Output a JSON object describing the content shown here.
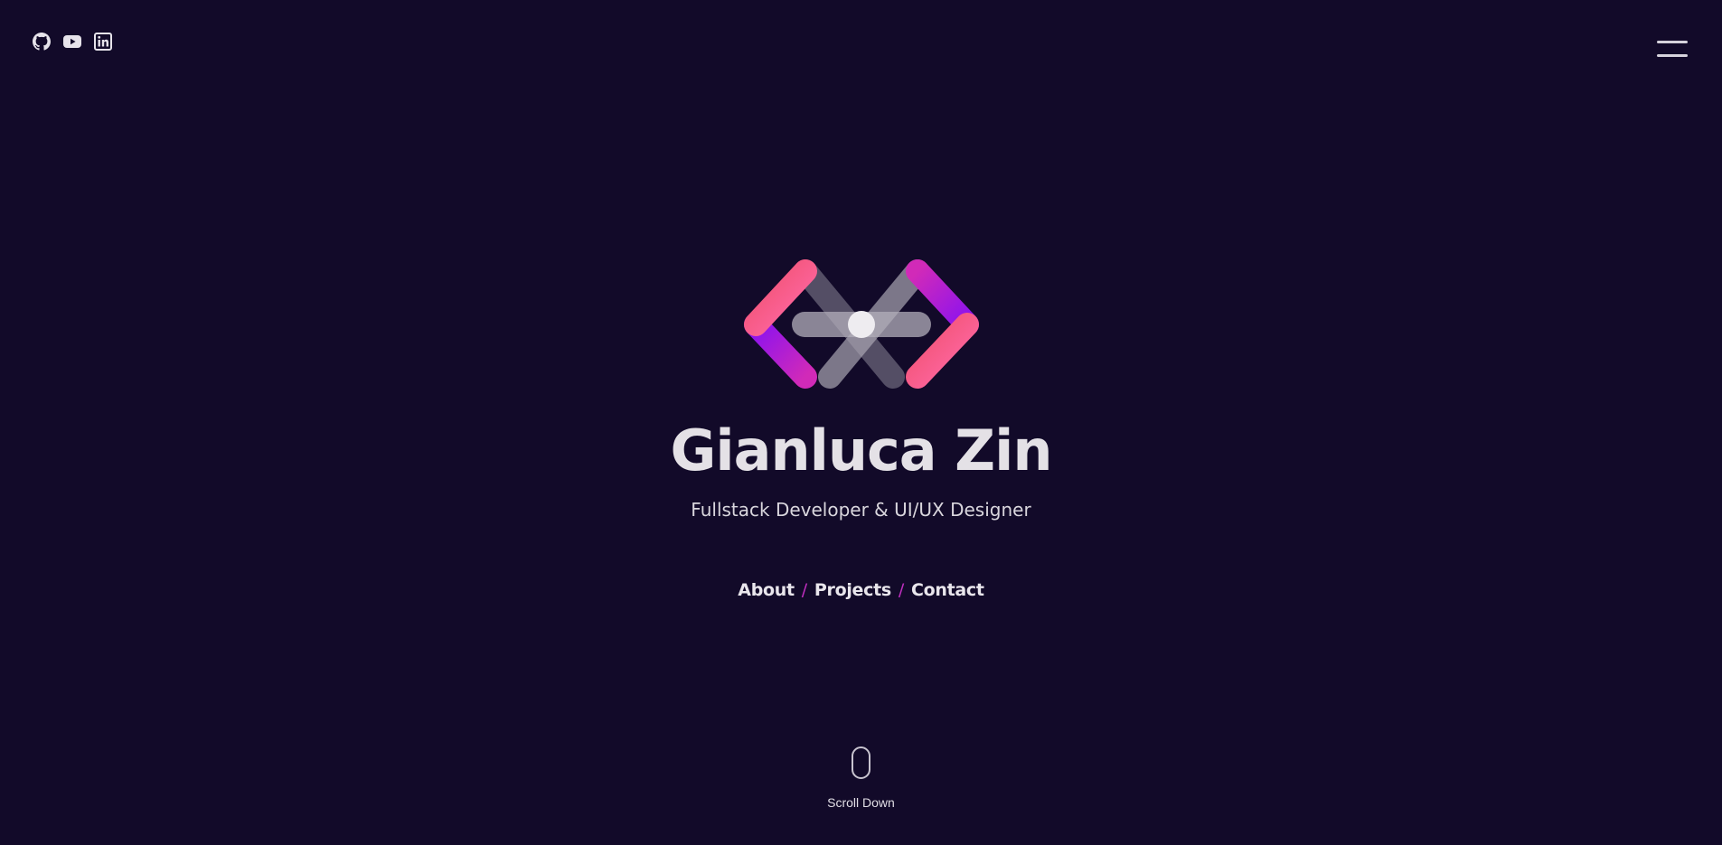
{
  "social": {
    "github_icon": "github-icon",
    "youtube_icon": "youtube-icon",
    "linkedin_icon": "linkedin-icon"
  },
  "menu": {
    "icon": "hamburger-menu-icon"
  },
  "hero": {
    "name": "Gianluca Zin",
    "tagline": "Fullstack Developer & UI/UX Designer"
  },
  "nav": {
    "items": [
      {
        "label": "About"
      },
      {
        "label": "Projects"
      },
      {
        "label": "Contact"
      }
    ],
    "separator": "/"
  },
  "scroll": {
    "label": "Scroll Down",
    "icon": "mouse-icon"
  },
  "colors": {
    "background": "#120a29",
    "accent_pink": "#f5537a",
    "accent_purple": "#9b18e6",
    "separator": "#c02fc0"
  }
}
